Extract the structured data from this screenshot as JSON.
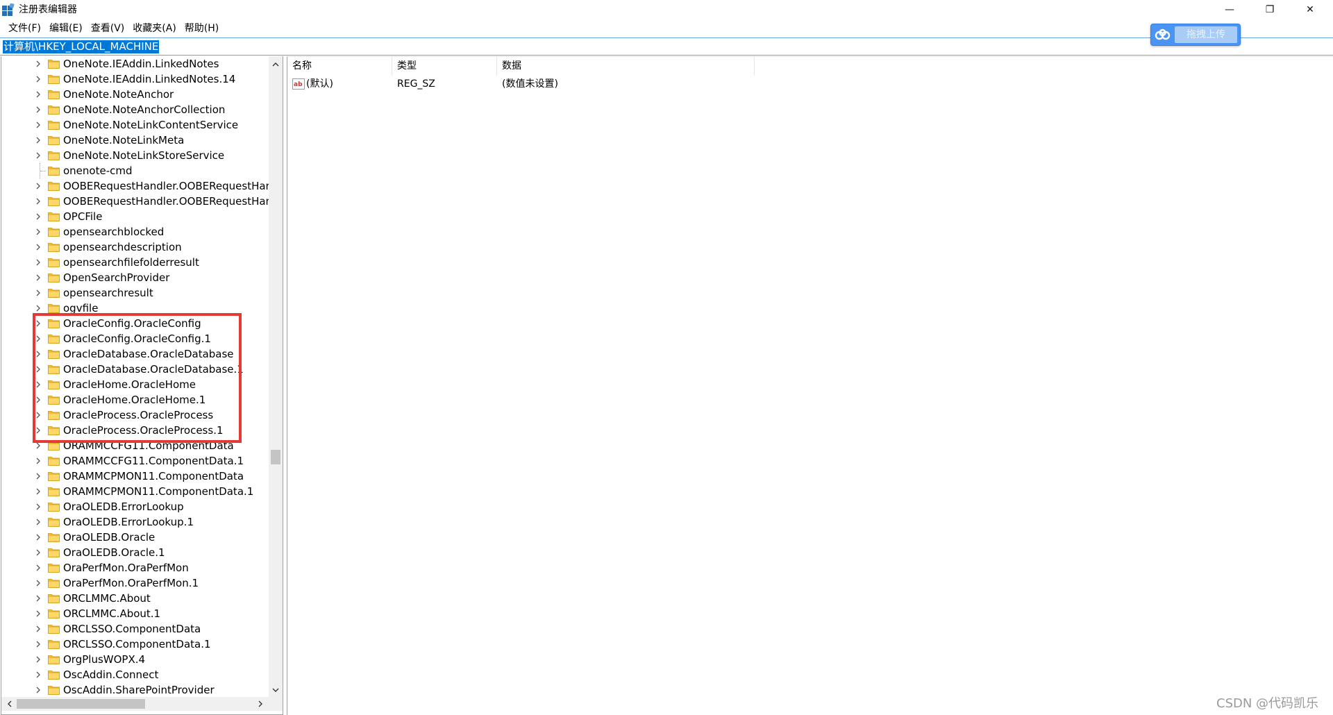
{
  "window": {
    "title": "注册表编辑器",
    "controls": {
      "minimize": "—",
      "restore": "❐",
      "close": "✕"
    }
  },
  "menu": [
    "文件(F)",
    "编辑(E)",
    "查看(V)",
    "收藏夹(A)",
    "帮助(H)"
  ],
  "address": "计算机\\HKEY_LOCAL_MACHINE",
  "upload_button": {
    "label": "拖拽上传"
  },
  "tree": {
    "items": [
      {
        "label": "OneNote.IEAddin.LinkedNotes",
        "expandable": true
      },
      {
        "label": "OneNote.IEAddin.LinkedNotes.14",
        "expandable": true
      },
      {
        "label": "OneNote.NoteAnchor",
        "expandable": true
      },
      {
        "label": "OneNote.NoteAnchorCollection",
        "expandable": true
      },
      {
        "label": "OneNote.NoteLinkContentService",
        "expandable": true
      },
      {
        "label": "OneNote.NoteLinkMeta",
        "expandable": true
      },
      {
        "label": "OneNote.NoteLinkStoreService",
        "expandable": true
      },
      {
        "label": "onenote-cmd",
        "expandable": false
      },
      {
        "label": "OOBERequestHandler.OOBERequestHan",
        "expandable": true
      },
      {
        "label": "OOBERequestHandler.OOBERequestHan",
        "expandable": true
      },
      {
        "label": "OPCFile",
        "expandable": true
      },
      {
        "label": "opensearchblocked",
        "expandable": true
      },
      {
        "label": "opensearchdescription",
        "expandable": true
      },
      {
        "label": "opensearchfilefolderresult",
        "expandable": true
      },
      {
        "label": "OpenSearchProvider",
        "expandable": true
      },
      {
        "label": "opensearchresult",
        "expandable": true
      },
      {
        "label": "ogvfile",
        "expandable": true
      },
      {
        "label": "OracleConfig.OracleConfig",
        "expandable": true
      },
      {
        "label": "OracleConfig.OracleConfig.1",
        "expandable": true
      },
      {
        "label": "OracleDatabase.OracleDatabase",
        "expandable": true
      },
      {
        "label": "OracleDatabase.OracleDatabase.1",
        "expandable": true
      },
      {
        "label": "OracleHome.OracleHome",
        "expandable": true
      },
      {
        "label": "OracleHome.OracleHome.1",
        "expandable": true
      },
      {
        "label": "OracleProcess.OracleProcess",
        "expandable": true
      },
      {
        "label": "OracleProcess.OracleProcess.1",
        "expandable": true
      },
      {
        "label": "ORAMMCCFG11.ComponentData",
        "expandable": true
      },
      {
        "label": "ORAMMCCFG11.ComponentData.1",
        "expandable": true
      },
      {
        "label": "ORAMMCPMON11.ComponentData",
        "expandable": true
      },
      {
        "label": "ORAMMCPMON11.ComponentData.1",
        "expandable": true
      },
      {
        "label": "OraOLEDB.ErrorLookup",
        "expandable": true
      },
      {
        "label": "OraOLEDB.ErrorLookup.1",
        "expandable": true
      },
      {
        "label": "OraOLEDB.Oracle",
        "expandable": true
      },
      {
        "label": "OraOLEDB.Oracle.1",
        "expandable": true
      },
      {
        "label": "OraPerfMon.OraPerfMon",
        "expandable": true
      },
      {
        "label": "OraPerfMon.OraPerfMon.1",
        "expandable": true
      },
      {
        "label": "ORCLMMC.About",
        "expandable": true
      },
      {
        "label": "ORCLMMC.About.1",
        "expandable": true
      },
      {
        "label": "ORCLSSO.ComponentData",
        "expandable": true
      },
      {
        "label": "ORCLSSO.ComponentData.1",
        "expandable": true
      },
      {
        "label": "OrgPlusWOPX.4",
        "expandable": true
      },
      {
        "label": "OscAddin.Connect",
        "expandable": true
      },
      {
        "label": "OscAddin.SharePointProvider",
        "expandable": true
      }
    ]
  },
  "values": {
    "columns": [
      "名称",
      "类型",
      "数据"
    ],
    "rows": [
      {
        "icon": "string-value-icon",
        "name": "(默认)",
        "type": "REG_SZ",
        "data": "(数值未设置)"
      }
    ]
  },
  "watermark": "CSDN @代码凯乐",
  "colors": {
    "selection": "#0078d7",
    "highlight_box": "#e53935",
    "folder": "#f5c342",
    "upload_button": "#4a94f3"
  }
}
